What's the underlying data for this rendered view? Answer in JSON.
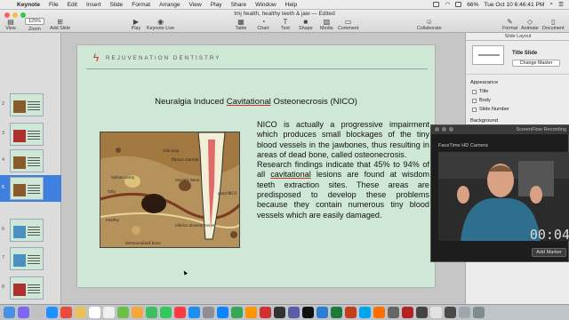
{
  "menubar": {
    "app": "Keynote",
    "items": [
      "File",
      "Edit",
      "Insert",
      "Slide",
      "Format",
      "Arrange",
      "View",
      "Play",
      "Share",
      "Window",
      "Help"
    ],
    "battery": "66%",
    "clock": "Tue Oct 10  6:46:41 PM"
  },
  "window": {
    "title": "tmj health, healthy teeth & jaw — Edited"
  },
  "toolbar": {
    "zoom_value": "125%",
    "view": "View",
    "zoom": "Zoom",
    "add_slide": "Add Slide",
    "play": "Play",
    "keynote_live": "Keynote Live",
    "table": "Table",
    "chart": "Chart",
    "text": "Text",
    "shape": "Shape",
    "media": "Media",
    "comment": "Comment",
    "collaborate": "Collaborate",
    "format": "Format",
    "animate": "Animate",
    "document": "Document"
  },
  "navigator": {
    "slides": [
      {
        "num": "2"
      },
      {
        "num": "3"
      },
      {
        "num": "4"
      },
      {
        "num": "5"
      },
      {
        "num": "6"
      },
      {
        "num": "7"
      },
      {
        "num": "8"
      }
    ]
  },
  "slide": {
    "logo_text": "REJUVENATION DENTISTRY",
    "title_pre": "Neuralgia Induced ",
    "title_u": "Cavitational",
    "title_post": " Osteonecrosis (NICO)",
    "para1": "NICO is actually a progressive impairment which produces small blockages of the tiny blood vessels in the jawbones, thus resulting in areas of dead bone, called osteonecrosis.",
    "para2_pre": "Research findings indicate that 45% to 94% of all ",
    "para2_u": "cavitational",
    "para2_post": " lesions are found at wisdom teeth extraction sites.  These areas are predisposed to develop these problems because they contain numerous tiny blood vessels which are easily damaged.",
    "diagram_labels": [
      "vital pulp",
      "fibrous marrow",
      "necrotic bone",
      "hollow cavity",
      "fatty",
      "good NICO",
      "inferior alveolar nerve",
      "demineralized bone",
      "healthy"
    ]
  },
  "inspector": {
    "tab": "Slide Layout",
    "layout_name": "Title Slide",
    "change_master": "Change Master",
    "appearance": "Appearance",
    "options": [
      "Title",
      "Body",
      "Slide Number"
    ],
    "background": "Background"
  },
  "facetime": {
    "title": "ScreenFlow Recording",
    "camera": "FaceTime HD Camera",
    "timer": "00:04",
    "add_marker": "Add Marker"
  },
  "colors": {
    "slide_bg": "#cfe8d5",
    "selection": "#3f7fdf",
    "logo_red": "#c0392b"
  }
}
